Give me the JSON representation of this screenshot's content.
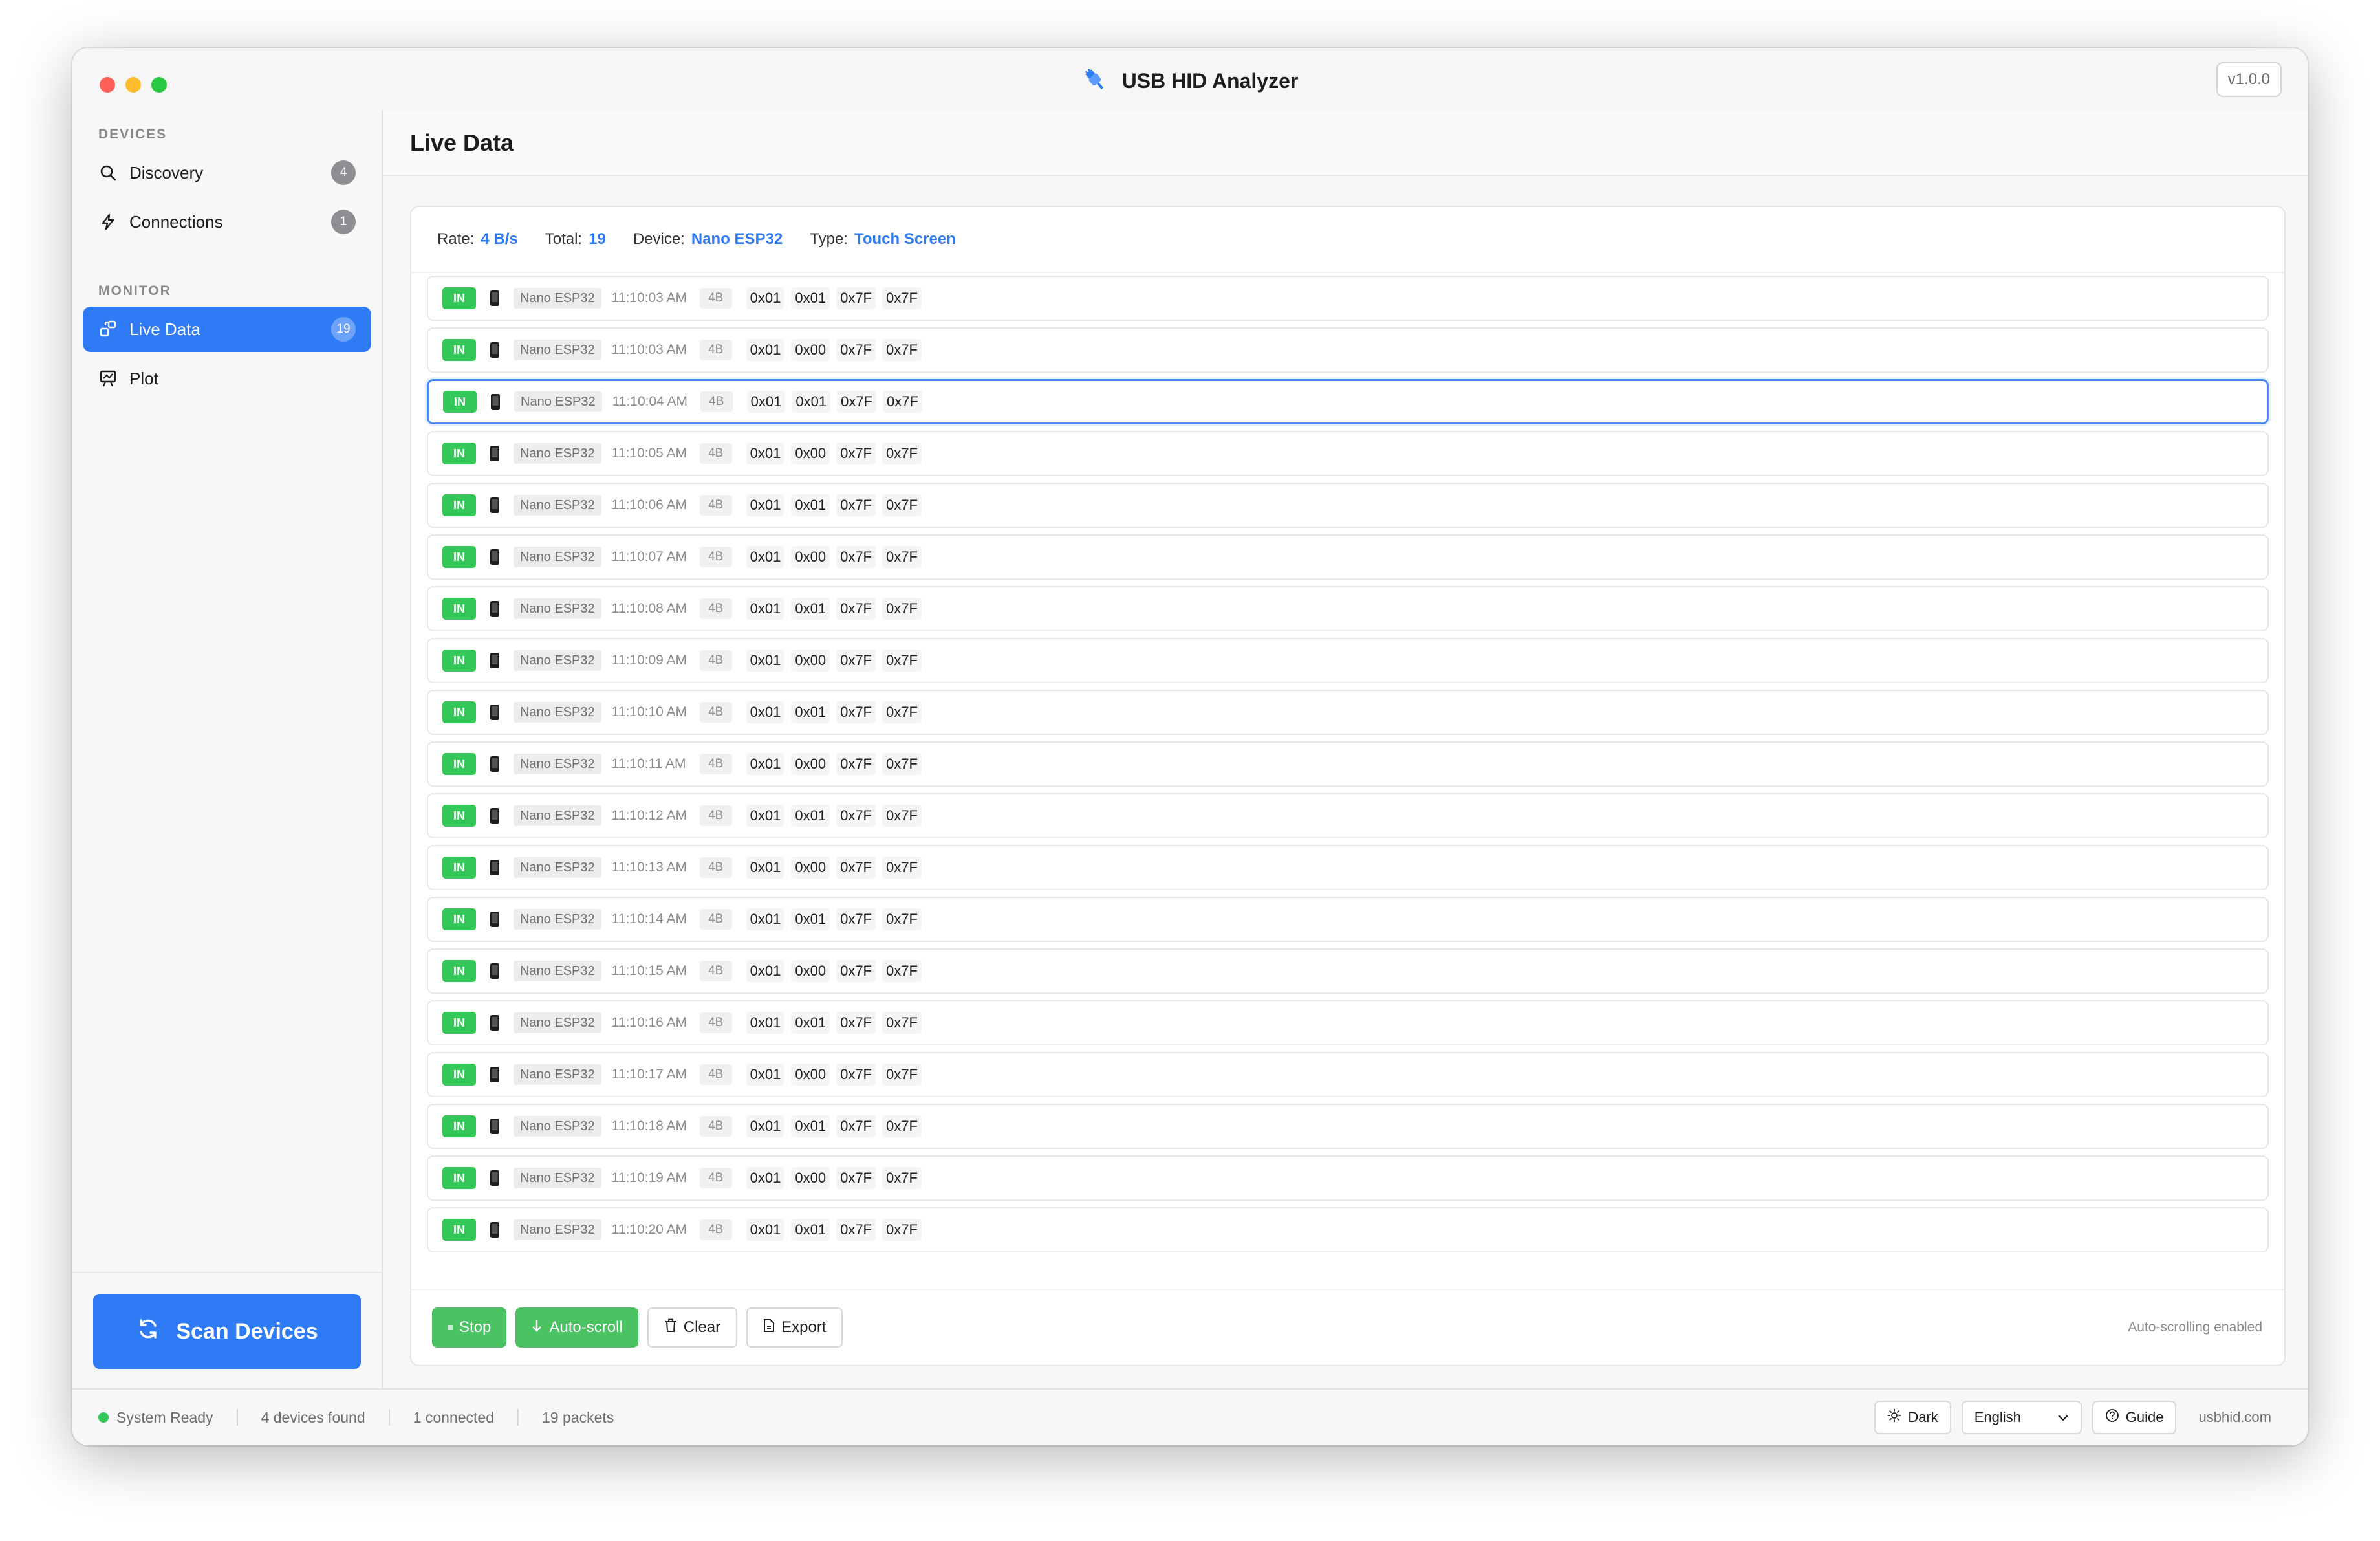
{
  "app": {
    "title": "USB HID Analyzer",
    "version": "v1.0.0",
    "accent_color": "#2f7bf5",
    "in_color": "#34c759"
  },
  "sidebar": {
    "devices_section": "DEVICES",
    "monitor_section": "MONITOR",
    "items": [
      {
        "label": "Discovery",
        "count": "4",
        "icon": "search-icon"
      },
      {
        "label": "Connections",
        "count": "1",
        "icon": "bolt-icon"
      },
      {
        "label": "Live Data",
        "count": "19",
        "icon": "live-data-icon",
        "active": true
      },
      {
        "label": "Plot",
        "icon": "plot-icon"
      }
    ],
    "scan_button": "Scan Devices"
  },
  "main": {
    "title": "Live Data",
    "stats": {
      "rate_label": "Rate:",
      "rate_value": "4 B/s",
      "total_label": "Total:",
      "total_value": "19",
      "device_label": "Device:",
      "device_value": "Nano ESP32",
      "type_label": "Type:",
      "type_value": "Touch Screen"
    },
    "packets": [
      {
        "dir": "IN",
        "device": "Nano ESP32",
        "time": "11:10:03 AM",
        "size": "4B",
        "bytes": [
          "0x01",
          "0x01",
          "0x7F",
          "0x7F"
        ]
      },
      {
        "dir": "IN",
        "device": "Nano ESP32",
        "time": "11:10:03 AM",
        "size": "4B",
        "bytes": [
          "0x01",
          "0x00",
          "0x7F",
          "0x7F"
        ]
      },
      {
        "dir": "IN",
        "device": "Nano ESP32",
        "time": "11:10:04 AM",
        "size": "4B",
        "bytes": [
          "0x01",
          "0x01",
          "0x7F",
          "0x7F"
        ],
        "selected": true
      },
      {
        "dir": "IN",
        "device": "Nano ESP32",
        "time": "11:10:05 AM",
        "size": "4B",
        "bytes": [
          "0x01",
          "0x00",
          "0x7F",
          "0x7F"
        ]
      },
      {
        "dir": "IN",
        "device": "Nano ESP32",
        "time": "11:10:06 AM",
        "size": "4B",
        "bytes": [
          "0x01",
          "0x01",
          "0x7F",
          "0x7F"
        ]
      },
      {
        "dir": "IN",
        "device": "Nano ESP32",
        "time": "11:10:07 AM",
        "size": "4B",
        "bytes": [
          "0x01",
          "0x00",
          "0x7F",
          "0x7F"
        ]
      },
      {
        "dir": "IN",
        "device": "Nano ESP32",
        "time": "11:10:08 AM",
        "size": "4B",
        "bytes": [
          "0x01",
          "0x01",
          "0x7F",
          "0x7F"
        ]
      },
      {
        "dir": "IN",
        "device": "Nano ESP32",
        "time": "11:10:09 AM",
        "size": "4B",
        "bytes": [
          "0x01",
          "0x00",
          "0x7F",
          "0x7F"
        ]
      },
      {
        "dir": "IN",
        "device": "Nano ESP32",
        "time": "11:10:10 AM",
        "size": "4B",
        "bytes": [
          "0x01",
          "0x01",
          "0x7F",
          "0x7F"
        ]
      },
      {
        "dir": "IN",
        "device": "Nano ESP32",
        "time": "11:10:11 AM",
        "size": "4B",
        "bytes": [
          "0x01",
          "0x00",
          "0x7F",
          "0x7F"
        ]
      },
      {
        "dir": "IN",
        "device": "Nano ESP32",
        "time": "11:10:12 AM",
        "size": "4B",
        "bytes": [
          "0x01",
          "0x01",
          "0x7F",
          "0x7F"
        ]
      },
      {
        "dir": "IN",
        "device": "Nano ESP32",
        "time": "11:10:13 AM",
        "size": "4B",
        "bytes": [
          "0x01",
          "0x00",
          "0x7F",
          "0x7F"
        ]
      },
      {
        "dir": "IN",
        "device": "Nano ESP32",
        "time": "11:10:14 AM",
        "size": "4B",
        "bytes": [
          "0x01",
          "0x01",
          "0x7F",
          "0x7F"
        ]
      },
      {
        "dir": "IN",
        "device": "Nano ESP32",
        "time": "11:10:15 AM",
        "size": "4B",
        "bytes": [
          "0x01",
          "0x00",
          "0x7F",
          "0x7F"
        ]
      },
      {
        "dir": "IN",
        "device": "Nano ESP32",
        "time": "11:10:16 AM",
        "size": "4B",
        "bytes": [
          "0x01",
          "0x01",
          "0x7F",
          "0x7F"
        ]
      },
      {
        "dir": "IN",
        "device": "Nano ESP32",
        "time": "11:10:17 AM",
        "size": "4B",
        "bytes": [
          "0x01",
          "0x00",
          "0x7F",
          "0x7F"
        ]
      },
      {
        "dir": "IN",
        "device": "Nano ESP32",
        "time": "11:10:18 AM",
        "size": "4B",
        "bytes": [
          "0x01",
          "0x01",
          "0x7F",
          "0x7F"
        ]
      },
      {
        "dir": "IN",
        "device": "Nano ESP32",
        "time": "11:10:19 AM",
        "size": "4B",
        "bytes": [
          "0x01",
          "0x00",
          "0x7F",
          "0x7F"
        ]
      },
      {
        "dir": "IN",
        "device": "Nano ESP32",
        "time": "11:10:20 AM",
        "size": "4B",
        "bytes": [
          "0x01",
          "0x01",
          "0x7F",
          "0x7F"
        ]
      }
    ],
    "controls": {
      "stop": "Stop",
      "autoscroll": "Auto-scroll",
      "clear": "Clear",
      "export": "Export",
      "note": "Auto-scrolling enabled"
    }
  },
  "statusbar": {
    "status": "System Ready",
    "devices_found": "4 devices found",
    "connected": "1 connected",
    "packets": "19 packets",
    "theme": "Dark",
    "language": "English",
    "guide": "Guide",
    "website": "usbhid.com"
  }
}
